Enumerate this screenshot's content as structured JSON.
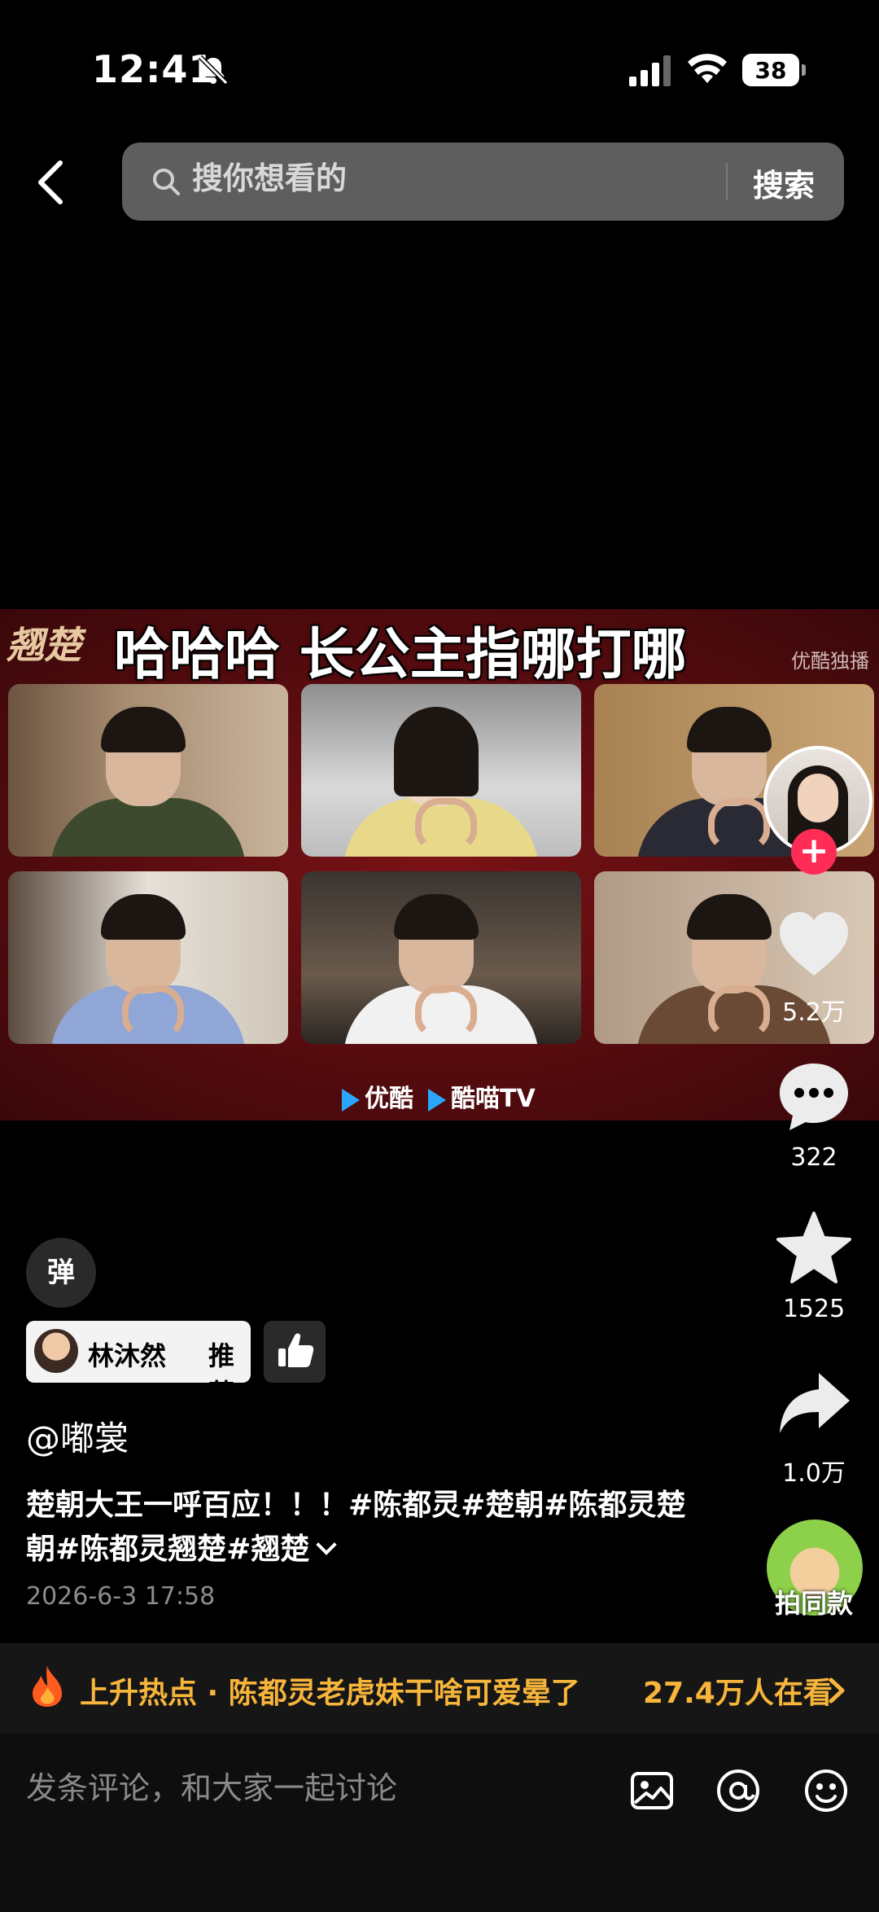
{
  "status_bar": {
    "time": "12:41",
    "battery": "38",
    "icons": [
      "bell-slash-icon",
      "signal-icon",
      "wifi-icon",
      "battery-icon"
    ]
  },
  "search": {
    "placeholder": "搜你想看的",
    "button": "搜索"
  },
  "video": {
    "logo": "翘楚",
    "caption": "哈哈哈 长公主指哪打哪",
    "watermark": "优酷独播",
    "brand_1": "优酷",
    "brand_2": "酷喵TV"
  },
  "actions": {
    "likes": "5.2万",
    "comments": "322",
    "favorites": "1525",
    "shares": "1.0万",
    "icons": [
      "heart-icon",
      "comment-icon",
      "star-icon",
      "share-icon"
    ]
  },
  "danmu": {
    "label": "弹"
  },
  "recommend": {
    "name": "林沐然",
    "action": "推荐"
  },
  "post": {
    "author": "@嘟裳",
    "description": "楚朝大王一呼百应！！！#陈都灵#楚朝#陈都灵楚朝#陈都灵翘楚#翘楚",
    "time": "2026-6-3 17:58"
  },
  "same_style": {
    "label": "拍同款"
  },
  "hot": {
    "text": "上升热点 · 陈都灵老虎妹干啥可爱晕了",
    "count": "27.4万人在看"
  },
  "comment": {
    "placeholder": "发条评论，和大家一起讨论"
  },
  "colors": {
    "accent_hot": "#f7b53b",
    "follow": "#ff2d55",
    "background": "#000000"
  }
}
